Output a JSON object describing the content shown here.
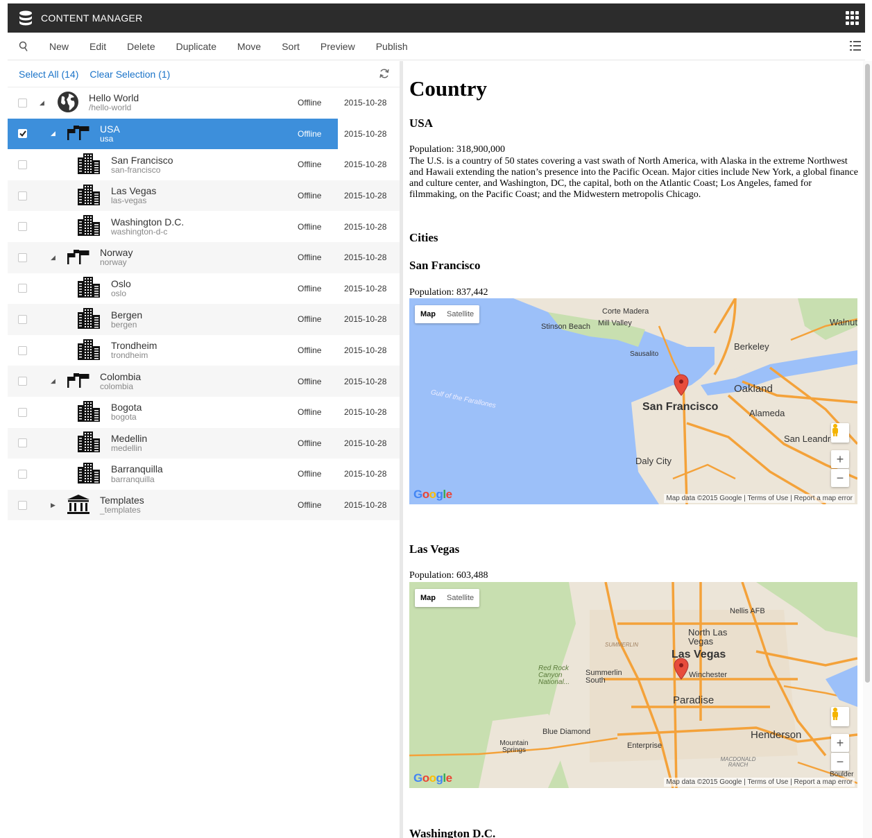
{
  "app": {
    "title": "CONTENT MANAGER"
  },
  "toolbar": {
    "buttons": [
      "New",
      "Edit",
      "Delete",
      "Duplicate",
      "Move",
      "Sort",
      "Preview",
      "Publish"
    ]
  },
  "selection": {
    "select_all": "Select All (14)",
    "clear_selection": "Clear Selection (1)"
  },
  "tree": [
    {
      "name": "Hello World",
      "path": "/hello-world",
      "status": "Offline",
      "date": "2015-10-28",
      "icon": "globe-icon",
      "level": 0,
      "expanded": true,
      "checked": false,
      "selected": false
    },
    {
      "name": "USA",
      "path": "usa",
      "status": "Offline",
      "date": "2015-10-28",
      "icon": "flags-icon",
      "level": 1,
      "expanded": true,
      "checked": true,
      "selected": true
    },
    {
      "name": "San Francisco",
      "path": "san-francisco",
      "status": "Offline",
      "date": "2015-10-28",
      "icon": "building-icon",
      "level": 2,
      "checked": false,
      "selected": false
    },
    {
      "name": "Las Vegas",
      "path": "las-vegas",
      "status": "Offline",
      "date": "2015-10-28",
      "icon": "building-icon",
      "level": 2,
      "checked": false,
      "selected": false
    },
    {
      "name": "Washington D.C.",
      "path": "washington-d-c",
      "status": "Offline",
      "date": "2015-10-28",
      "icon": "building-icon",
      "level": 2,
      "checked": false,
      "selected": false
    },
    {
      "name": "Norway",
      "path": "norway",
      "status": "Offline",
      "date": "2015-10-28",
      "icon": "flags-icon",
      "level": 1,
      "expanded": true,
      "checked": false,
      "selected": false
    },
    {
      "name": "Oslo",
      "path": "oslo",
      "status": "Offline",
      "date": "2015-10-28",
      "icon": "building-icon",
      "level": 2,
      "checked": false,
      "selected": false
    },
    {
      "name": "Bergen",
      "path": "bergen",
      "status": "Offline",
      "date": "2015-10-28",
      "icon": "building-icon",
      "level": 2,
      "checked": false,
      "selected": false
    },
    {
      "name": "Trondheim",
      "path": "trondheim",
      "status": "Offline",
      "date": "2015-10-28",
      "icon": "building-icon",
      "level": 2,
      "checked": false,
      "selected": false
    },
    {
      "name": "Colombia",
      "path": "colombia",
      "status": "Offline",
      "date": "2015-10-28",
      "icon": "flags-icon",
      "level": 1,
      "expanded": true,
      "checked": false,
      "selected": false
    },
    {
      "name": "Bogota",
      "path": "bogota",
      "status": "Offline",
      "date": "2015-10-28",
      "icon": "building-icon",
      "level": 2,
      "checked": false,
      "selected": false
    },
    {
      "name": "Medellin",
      "path": "medellin",
      "status": "Offline",
      "date": "2015-10-28",
      "icon": "building-icon",
      "level": 2,
      "checked": false,
      "selected": false
    },
    {
      "name": "Barranquilla",
      "path": "barranquilla",
      "status": "Offline",
      "date": "2015-10-28",
      "icon": "building-icon",
      "level": 2,
      "checked": false,
      "selected": false
    },
    {
      "name": "Templates",
      "path": "_templates",
      "status": "Offline",
      "date": "2015-10-28",
      "icon": "temple-icon",
      "level": 1,
      "expanded": false,
      "checked": false,
      "selected": false
    }
  ],
  "preview": {
    "heading": "Country",
    "country": "USA",
    "population": "Population: 318,900,000",
    "description": "The U.S. is a country of 50 states covering a vast swath of North America, with Alaska in the extreme Northwest and Hawaii extending the nation’s presence into the Pacific Ocean. Major cities include New York, a global finance and culture center, and Washington, DC, the capital, both on the Atlantic Coast; Los Angeles, famed for filmmaking, on the Pacific Coast; and the Midwestern metropolis Chicago.",
    "cities_heading": "Cities",
    "cities": [
      {
        "name": "San Francisco",
        "population": "Population: 837,442"
      },
      {
        "name": "Las Vegas",
        "population": "Population: 603,488"
      },
      {
        "name": "Washington D.C."
      }
    ],
    "map_ui": {
      "tab_map": "Map",
      "tab_satellite": "Satellite",
      "brand": "Google",
      "attribution": "Map data ©2015 Google  |  Terms of Use  |  Report a map error",
      "zoom_in": "+",
      "zoom_out": "−"
    },
    "sf_map_labels": [
      "Corte Madera",
      "Mill Valley",
      "Stinson Beach",
      "Sausalito",
      "Berkeley",
      "Walnut",
      "Oakland",
      "Alameda",
      "San Francisco",
      "San Leandro",
      "Daly City",
      "Gulf of the Farallones"
    ],
    "lv_map_labels": [
      "Nellis AFB",
      "North Las Vegas",
      "Las Vegas",
      "Summerlin South",
      "Red Rock Canyon National...",
      "Winchester",
      "Paradise",
      "Henderson",
      "Blue Diamond",
      "Mountain Springs",
      "Enterprise",
      "MACDONALD RANCH",
      "Boulder",
      "SUMMERLIN"
    ]
  },
  "colors": {
    "topbar": "#2c2c2c",
    "selected_row": "#3d8fdb",
    "link": "#1a73c8",
    "water": "#9cc0f9",
    "land": "#ece5d8",
    "park": "#c8dfb0",
    "highway": "#f4a23a"
  }
}
